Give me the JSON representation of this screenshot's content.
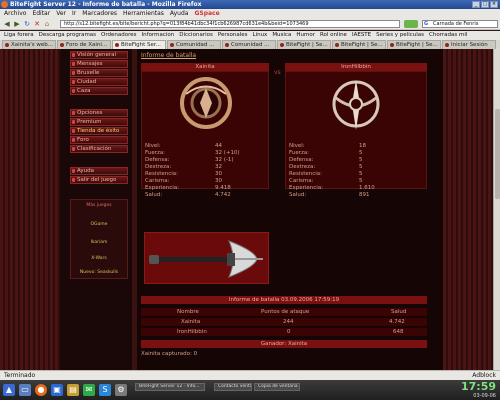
{
  "window": {
    "title": "BiteFight Server 12 - Informe de batalla - Mozilla Firefox"
  },
  "menubar": [
    "Archivo",
    "Editar",
    "Ver",
    "Ir",
    "Marcadores",
    "Herramientas",
    "Ayuda",
    "GSpace"
  ],
  "navbar": {
    "url": "http://s12.bitefight.es/bite/bericht.php?q=013f84b41dbc34f1cb626987cd631e4b&beid=1073469",
    "search_placeholder": "Carnada de Fenris",
    "search_engine_glyph": "G"
  },
  "bookmarks": [
    "Liga forera",
    "Descarga programas",
    "Ordenadores",
    "Informacion",
    "Diccionarios",
    "Personales",
    "Linux",
    "Musica",
    "Humor",
    "Rol online",
    "IAESTE",
    "Series y peliculas",
    "Chorradas mil"
  ],
  "tabs": [
    "Xainita's web...",
    "Foro de Xaini...",
    "BiteFight Ser...",
    "Comunidad ...",
    "Comunidad ...",
    "BiteFight | Se...",
    "BiteFight | Se...",
    "BiteFight | Se...",
    "Iniciar Sesión"
  ],
  "active_tab_index": 2,
  "sidebar": {
    "items": [
      "Visión general",
      "Mensajes",
      "Bruxelle",
      "Ciudad",
      "Caza",
      "Opciones",
      "Premium",
      "Tienda de éxito",
      "Foro",
      "Clasificación",
      "Ayuda",
      "Salir del juego"
    ],
    "highlight_index": 7,
    "box_labels": [
      "Más juegos",
      "OGame",
      "Ikariam",
      "X-Wars",
      "Nuevo: Seaskulls"
    ]
  },
  "report": {
    "title": "Informe de batalla",
    "vs_label": "vs",
    "attacker": {
      "name": "Xainita",
      "stats": [
        {
          "label": "Nivel:",
          "value": "44"
        },
        {
          "label": "Fuerza:",
          "value": "32 (+10)"
        },
        {
          "label": "Defensa:",
          "value": "32 (-1)"
        },
        {
          "label": "Destreza:",
          "value": "32"
        },
        {
          "label": "Resistencia:",
          "value": "30"
        },
        {
          "label": "Carisma:",
          "value": "30"
        },
        {
          "label": "Experiencia:",
          "value": "9.418"
        },
        {
          "label": "Salud:",
          "value": "4.742"
        }
      ]
    },
    "defender": {
      "name": "IronHilbbin",
      "stats": [
        {
          "label": "Nivel:",
          "value": "18"
        },
        {
          "label": "Fuerza:",
          "value": "5"
        },
        {
          "label": "Defensa:",
          "value": "5"
        },
        {
          "label": "Destreza:",
          "value": "5"
        },
        {
          "label": "Resistencia:",
          "value": "5"
        },
        {
          "label": "Carisma:",
          "value": "5"
        },
        {
          "label": "Experiencia:",
          "value": "1.610"
        },
        {
          "label": "Salud:",
          "value": "891"
        }
      ]
    },
    "summary": {
      "header": "Informe de batalla 03.09.2006 17:59:19",
      "columns": [
        "Nombre",
        "Puntos de ataque",
        "Salud"
      ],
      "rows": [
        [
          "Xainita",
          "244",
          "4.742"
        ],
        [
          "IronHilbbin",
          "0",
          "648"
        ]
      ],
      "winner_label": "Ganador: Xainita",
      "captured_label": "Xainita capturado: 0"
    }
  },
  "statusbar": {
    "left": "Terminado",
    "right": "Adblock"
  },
  "taskbar": {
    "tasks": [
      "BiteFight Server 12 - Info...",
      "Contacto ventana",
      "Copia de ventana (GIMP)"
    ],
    "time": "17:59",
    "date": "03-09-06"
  },
  "colors": {
    "accent": "#7a1010",
    "panel": "#3a0404",
    "text": "#d6a08a"
  }
}
